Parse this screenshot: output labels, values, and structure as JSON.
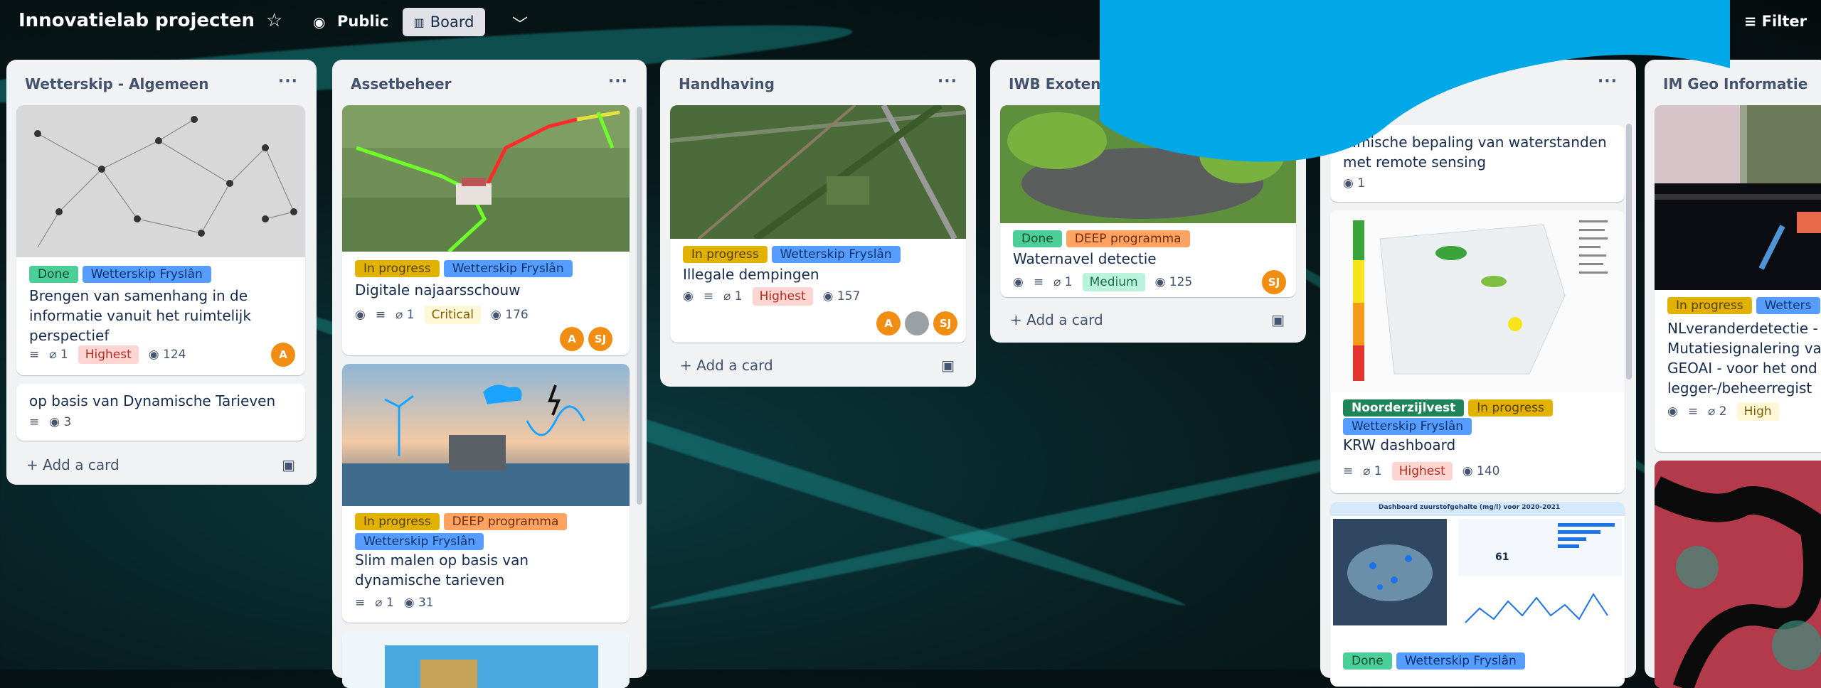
{
  "board": {
    "title": "Innovatielab projecten",
    "visibility": "Public",
    "view": "Board",
    "filter": "Filter"
  },
  "lists": [
    {
      "title": "Wetterskip - Algemeen",
      "add": "Add a card"
    },
    {
      "title": "Assetbeheer"
    },
    {
      "title": "Handhaving",
      "add": "Add a card"
    },
    {
      "title": "IWB Exotenb",
      "add": "Add a card"
    },
    {
      "title": ""
    },
    {
      "title": "IM Geo Informatie"
    }
  ],
  "cards": {
    "c1": {
      "labels": [
        "Done",
        "Wetterskip Fryslân"
      ],
      "title": "Brengen van samenhang in de informatie vanuit het ruimtelijk perspectief",
      "attach": "1",
      "priority": "Highest",
      "views": "124",
      "avatar": "A"
    },
    "c2": {
      "title": "op basis van Dynamische Tarieven",
      "views": "3"
    },
    "c3": {
      "labels": [
        "In progress",
        "Wetterskip Fryslân"
      ],
      "title": "Digitale najaarsschouw",
      "attach": "1",
      "priority": "Critical",
      "views": "176",
      "av1": "A",
      "av2": "SJ"
    },
    "c4": {
      "labels": [
        "In progress",
        "DEEP programma",
        "Wetterskip Fryslân"
      ],
      "title": "Slim malen op basis van dynamische tarieven",
      "attach": "1",
      "views": "31"
    },
    "c5": {
      "labels": [
        "In progress",
        "Wetterskip Fryslân"
      ],
      "title": "Illegale dempingen",
      "attach": "1",
      "priority": "Highest",
      "views": "157",
      "av1": "A",
      "av3": "SJ"
    },
    "c6": {
      "labels": [
        "Done",
        "DEEP programma"
      ],
      "title": "Waternavel detectie",
      "attach": "1",
      "priority": "Medium",
      "views": "125",
      "avatar": "SJ"
    },
    "c7": {
      "title": "...mische bepaling van waterstanden met remote sensing",
      "views": "1"
    },
    "c8": {
      "labels": [
        "Noorderzijlvest",
        "In progress",
        "Wetterskip Fryslân"
      ],
      "title": "KRW dashboard",
      "attach": "1",
      "priority": "Highest",
      "views": "140"
    },
    "c9": {
      "labels": [
        "Done",
        "Wetterskip Fryslân"
      ],
      "header": "Dashboard zuurstofgehalte (mg/l) voor 2020-2021",
      "stat": "61"
    },
    "c10": {
      "labels": [
        "In progress",
        "Wetters"
      ],
      "title": "NLveranderdetectie - Mutatiesignalering va GEOAI - voor het ond legger-/beheerregist",
      "attach": "2",
      "priority": "High"
    }
  },
  "colors": {
    "done": "#4bce97",
    "done_text": "#164b35",
    "frys": "#579dff",
    "frys_text": "#09326c",
    "progress": "#e2b203",
    "progress_text": "#533f04",
    "deep": "#fea362",
    "deep_text": "#702e00",
    "noord": "#1f845a",
    "noord_text": "#ffffff",
    "highest_bg": "#ffd5d2",
    "highest_text": "#ae2e24",
    "critical_bg": "#fff7d6",
    "critical_text": "#7f5f01",
    "medium_bg": "#baf3db",
    "medium_text": "#216e4e",
    "avatar": "#f18d13",
    "overlay": "#00a8e8"
  },
  "icons": [
    "star-icon",
    "globe-icon",
    "board-icon",
    "chevron-down-icon",
    "filter-icon",
    "more-icon",
    "eye-icon",
    "description-icon",
    "attachment-icon",
    "plus-icon",
    "template-icon"
  ]
}
